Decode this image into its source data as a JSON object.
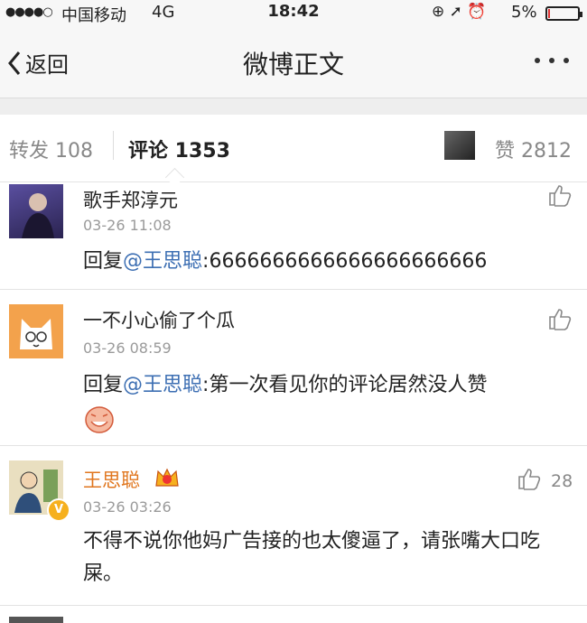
{
  "status_bar": {
    "signal": "●●●●○",
    "carrier": "中国移动",
    "network": "4G",
    "time": "18:42",
    "battery": "5%",
    "battery_level": 0.05
  },
  "nav": {
    "back_label": "返回",
    "title": "微博正文",
    "more_icon": "ellipsis-icon"
  },
  "tabs": {
    "repost": "转发 108",
    "comments": "评论 1353",
    "likes": "赞 2812"
  },
  "comments": [
    {
      "user": "歌手郑淳元",
      "time": "03-26 11:08",
      "reply_prefix": "回复",
      "mention": "@王思聪",
      "text": ":6666666666666666666666"
    },
    {
      "user": "一不小心偷了个瓜",
      "time": "03-26 08:59",
      "reply_prefix": "回复",
      "mention": "@王思聪",
      "text": ":第一次看见你的评论居然没人赞"
    },
    {
      "user": "王思聪",
      "time": "03-26 03:26",
      "text": "不得不说你他妈广告接的也太傻逼了，请张嘴大口吃屎。",
      "likes": "28",
      "user_color": "#e0761e",
      "verified": true
    }
  ]
}
